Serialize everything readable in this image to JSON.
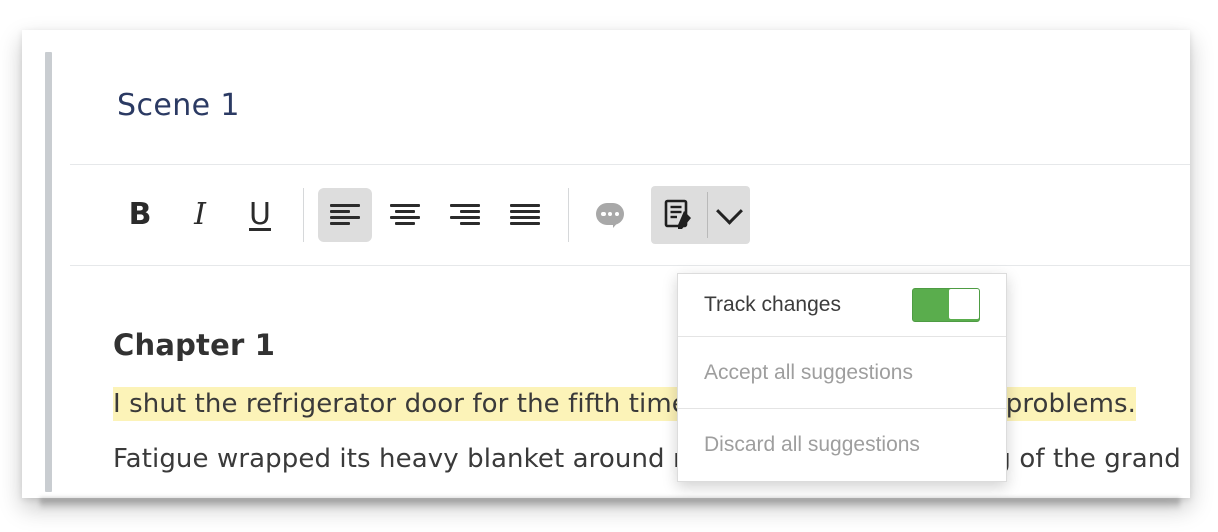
{
  "document": {
    "scene_title": "Scene 1",
    "chapter_heading": "Chapter 1",
    "paragraph_highlighted": "I shut the refrigerator door for the fifth time, as if the answer to my problems.",
    "paragraph_plain": "Fatigue wrapped its heavy blanket around my shoulders. The ticking of the grand",
    "highlight_color": "#fcf3b8",
    "title_color": "#2b3a63"
  },
  "toolbar": {
    "bold_label": "B",
    "italic_label": "I",
    "underline_label": "U",
    "align_left_name": "align-left",
    "align_center_name": "align-center",
    "align_right_name": "align-right",
    "align_justify_name": "align-justify",
    "comment_name": "comment-bubble",
    "track_changes_name": "track-changes",
    "dropdown_name": "chevron-down",
    "active_button": "align-left",
    "active_background": "#dddddd"
  },
  "track_menu": {
    "track_changes_label": "Track changes",
    "toggle_state": "on",
    "toggle_color": "#5aad4d",
    "accept_all_label": "Accept all suggestions",
    "accept_all_enabled": false,
    "discard_all_label": "Discard all suggestions",
    "discard_all_enabled": false,
    "disabled_color": "#9e9e9e"
  }
}
